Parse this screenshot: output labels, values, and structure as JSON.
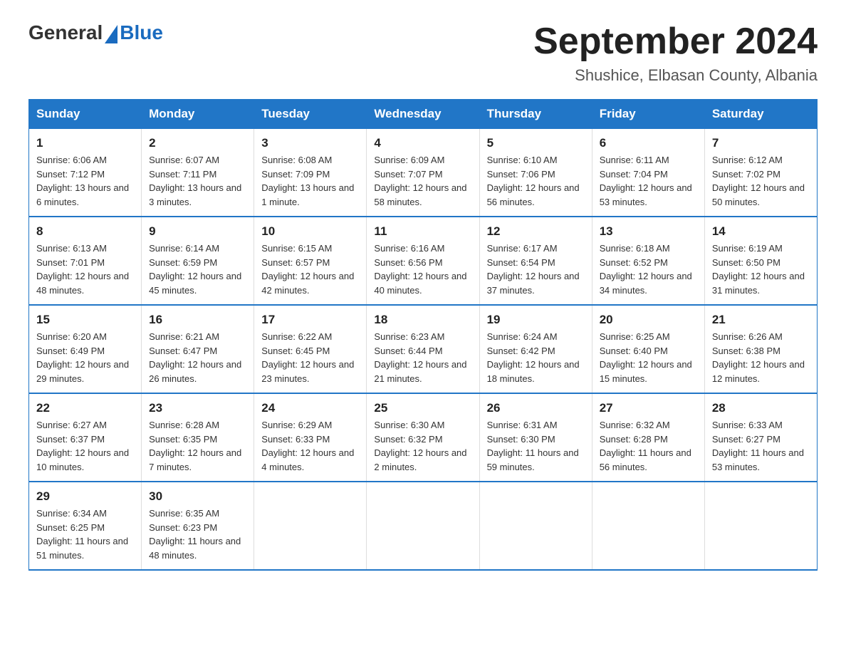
{
  "header": {
    "logo_general": "General",
    "logo_blue": "Blue",
    "calendar_title": "September 2024",
    "calendar_subtitle": "Shushice, Elbasan County, Albania"
  },
  "weekdays": [
    "Sunday",
    "Monday",
    "Tuesday",
    "Wednesday",
    "Thursday",
    "Friday",
    "Saturday"
  ],
  "weeks": [
    [
      {
        "day": "1",
        "sunrise": "6:06 AM",
        "sunset": "7:12 PM",
        "daylight": "13 hours and 6 minutes."
      },
      {
        "day": "2",
        "sunrise": "6:07 AM",
        "sunset": "7:11 PM",
        "daylight": "13 hours and 3 minutes."
      },
      {
        "day": "3",
        "sunrise": "6:08 AM",
        "sunset": "7:09 PM",
        "daylight": "13 hours and 1 minute."
      },
      {
        "day": "4",
        "sunrise": "6:09 AM",
        "sunset": "7:07 PM",
        "daylight": "12 hours and 58 minutes."
      },
      {
        "day": "5",
        "sunrise": "6:10 AM",
        "sunset": "7:06 PM",
        "daylight": "12 hours and 56 minutes."
      },
      {
        "day": "6",
        "sunrise": "6:11 AM",
        "sunset": "7:04 PM",
        "daylight": "12 hours and 53 minutes."
      },
      {
        "day": "7",
        "sunrise": "6:12 AM",
        "sunset": "7:02 PM",
        "daylight": "12 hours and 50 minutes."
      }
    ],
    [
      {
        "day": "8",
        "sunrise": "6:13 AM",
        "sunset": "7:01 PM",
        "daylight": "12 hours and 48 minutes."
      },
      {
        "day": "9",
        "sunrise": "6:14 AM",
        "sunset": "6:59 PM",
        "daylight": "12 hours and 45 minutes."
      },
      {
        "day": "10",
        "sunrise": "6:15 AM",
        "sunset": "6:57 PM",
        "daylight": "12 hours and 42 minutes."
      },
      {
        "day": "11",
        "sunrise": "6:16 AM",
        "sunset": "6:56 PM",
        "daylight": "12 hours and 40 minutes."
      },
      {
        "day": "12",
        "sunrise": "6:17 AM",
        "sunset": "6:54 PM",
        "daylight": "12 hours and 37 minutes."
      },
      {
        "day": "13",
        "sunrise": "6:18 AM",
        "sunset": "6:52 PM",
        "daylight": "12 hours and 34 minutes."
      },
      {
        "day": "14",
        "sunrise": "6:19 AM",
        "sunset": "6:50 PM",
        "daylight": "12 hours and 31 minutes."
      }
    ],
    [
      {
        "day": "15",
        "sunrise": "6:20 AM",
        "sunset": "6:49 PM",
        "daylight": "12 hours and 29 minutes."
      },
      {
        "day": "16",
        "sunrise": "6:21 AM",
        "sunset": "6:47 PM",
        "daylight": "12 hours and 26 minutes."
      },
      {
        "day": "17",
        "sunrise": "6:22 AM",
        "sunset": "6:45 PM",
        "daylight": "12 hours and 23 minutes."
      },
      {
        "day": "18",
        "sunrise": "6:23 AM",
        "sunset": "6:44 PM",
        "daylight": "12 hours and 21 minutes."
      },
      {
        "day": "19",
        "sunrise": "6:24 AM",
        "sunset": "6:42 PM",
        "daylight": "12 hours and 18 minutes."
      },
      {
        "day": "20",
        "sunrise": "6:25 AM",
        "sunset": "6:40 PM",
        "daylight": "12 hours and 15 minutes."
      },
      {
        "day": "21",
        "sunrise": "6:26 AM",
        "sunset": "6:38 PM",
        "daylight": "12 hours and 12 minutes."
      }
    ],
    [
      {
        "day": "22",
        "sunrise": "6:27 AM",
        "sunset": "6:37 PM",
        "daylight": "12 hours and 10 minutes."
      },
      {
        "day": "23",
        "sunrise": "6:28 AM",
        "sunset": "6:35 PM",
        "daylight": "12 hours and 7 minutes."
      },
      {
        "day": "24",
        "sunrise": "6:29 AM",
        "sunset": "6:33 PM",
        "daylight": "12 hours and 4 minutes."
      },
      {
        "day": "25",
        "sunrise": "6:30 AM",
        "sunset": "6:32 PM",
        "daylight": "12 hours and 2 minutes."
      },
      {
        "day": "26",
        "sunrise": "6:31 AM",
        "sunset": "6:30 PM",
        "daylight": "11 hours and 59 minutes."
      },
      {
        "day": "27",
        "sunrise": "6:32 AM",
        "sunset": "6:28 PM",
        "daylight": "11 hours and 56 minutes."
      },
      {
        "day": "28",
        "sunrise": "6:33 AM",
        "sunset": "6:27 PM",
        "daylight": "11 hours and 53 minutes."
      }
    ],
    [
      {
        "day": "29",
        "sunrise": "6:34 AM",
        "sunset": "6:25 PM",
        "daylight": "11 hours and 51 minutes."
      },
      {
        "day": "30",
        "sunrise": "6:35 AM",
        "sunset": "6:23 PM",
        "daylight": "11 hours and 48 minutes."
      },
      {
        "day": "",
        "sunrise": "",
        "sunset": "",
        "daylight": ""
      },
      {
        "day": "",
        "sunrise": "",
        "sunset": "",
        "daylight": ""
      },
      {
        "day": "",
        "sunrise": "",
        "sunset": "",
        "daylight": ""
      },
      {
        "day": "",
        "sunrise": "",
        "sunset": "",
        "daylight": ""
      },
      {
        "day": "",
        "sunrise": "",
        "sunset": "",
        "daylight": ""
      }
    ]
  ],
  "labels": {
    "sunrise": "Sunrise: ",
    "sunset": "Sunset: ",
    "daylight": "Daylight: "
  }
}
